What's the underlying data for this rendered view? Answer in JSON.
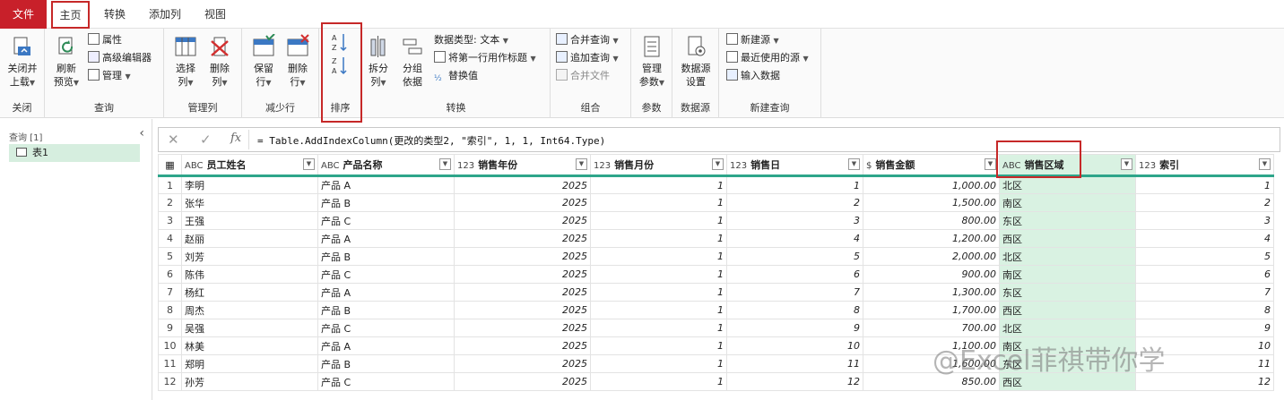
{
  "tabs": [
    "文件",
    "主页",
    "转换",
    "添加列",
    "视图"
  ],
  "ribbon": {
    "close_group": {
      "label": "关闭",
      "close_apply": "关闭并",
      "close_apply2": "上载"
    },
    "query_group": {
      "label": "查询",
      "refresh": "刷新",
      "refresh2": "预览",
      "properties": "属性",
      "advanced_editor": "高级编辑器",
      "manage": "管理"
    },
    "manage_cols_group": {
      "label": "管理列",
      "choose": "选择",
      "choose2": "列",
      "remove": "删除",
      "remove2": "列"
    },
    "reduce_rows_group": {
      "label": "减少行",
      "keep": "保留",
      "keep2": "行",
      "remove": "删除",
      "remove2": "行"
    },
    "sort_group": {
      "label": "排序"
    },
    "transform_group": {
      "label": "转换",
      "split": "拆分",
      "split2": "列",
      "group_by": "分组",
      "group_by2": "依据",
      "data_type": "数据类型: 文本",
      "first_row_header": "将第一行用作标题",
      "replace_values": "替换值"
    },
    "combine_group": {
      "label": "组合",
      "merge": "合并查询",
      "append": "追加查询",
      "combine_files": "合并文件"
    },
    "params_group": {
      "label": "参数",
      "manage": "管理",
      "manage2": "参数"
    },
    "datasource_group": {
      "label": "数据源",
      "settings": "数据源",
      "settings2": "设置"
    },
    "newquery_group": {
      "label": "新建查询",
      "new_source": "新建源",
      "recent": "最近使用的源",
      "enter_data": "输入数据"
    }
  },
  "queries": {
    "header": "查询 [1]",
    "items": [
      "表1"
    ]
  },
  "formula": {
    "fx": "fx",
    "text": "= Table.AddIndexColumn(更改的类型2, \"索引\", 1, 1, Int64.Type)"
  },
  "table": {
    "columns": [
      {
        "type": "ABC",
        "name": "员工姓名"
      },
      {
        "type": "ABC",
        "name": "产品名称"
      },
      {
        "type": "123",
        "name": "销售年份"
      },
      {
        "type": "123",
        "name": "销售月份"
      },
      {
        "type": "123",
        "name": "销售日"
      },
      {
        "type": "$",
        "name": "销售金额"
      },
      {
        "type": "ABC",
        "name": "销售区域"
      },
      {
        "type": "123",
        "name": "索引"
      }
    ],
    "rows": [
      [
        "1",
        "李明",
        "产品 A",
        "2025",
        "1",
        "1",
        "1,000.00",
        "北区",
        "1"
      ],
      [
        "2",
        "张华",
        "产品 B",
        "2025",
        "1",
        "2",
        "1,500.00",
        "南区",
        "2"
      ],
      [
        "3",
        "王强",
        "产品 C",
        "2025",
        "1",
        "3",
        "800.00",
        "东区",
        "3"
      ],
      [
        "4",
        "赵丽",
        "产品 A",
        "2025",
        "1",
        "4",
        "1,200.00",
        "西区",
        "4"
      ],
      [
        "5",
        "刘芳",
        "产品 B",
        "2025",
        "1",
        "5",
        "2,000.00",
        "北区",
        "5"
      ],
      [
        "6",
        "陈伟",
        "产品 C",
        "2025",
        "1",
        "6",
        "900.00",
        "南区",
        "6"
      ],
      [
        "7",
        "杨红",
        "产品 A",
        "2025",
        "1",
        "7",
        "1,300.00",
        "东区",
        "7"
      ],
      [
        "8",
        "周杰",
        "产品 B",
        "2025",
        "1",
        "8",
        "1,700.00",
        "西区",
        "8"
      ],
      [
        "9",
        "吴强",
        "产品 C",
        "2025",
        "1",
        "9",
        "700.00",
        "北区",
        "9"
      ],
      [
        "10",
        "林美",
        "产品 A",
        "2025",
        "1",
        "10",
        "1,100.00",
        "南区",
        "10"
      ],
      [
        "11",
        "郑明",
        "产品 B",
        "2025",
        "1",
        "11",
        "1,600.00",
        "东区",
        "11"
      ],
      [
        "12",
        "孙芳",
        "产品 C",
        "2025",
        "1",
        "12",
        "850.00",
        "西区",
        "12"
      ]
    ]
  },
  "watermark": "@Excel菲祺带你学",
  "colors": {
    "accent_red": "#c62828",
    "file_tab": "#c8202a",
    "selected_column": "#d9f2e2",
    "header_line": "#2ea58a"
  }
}
